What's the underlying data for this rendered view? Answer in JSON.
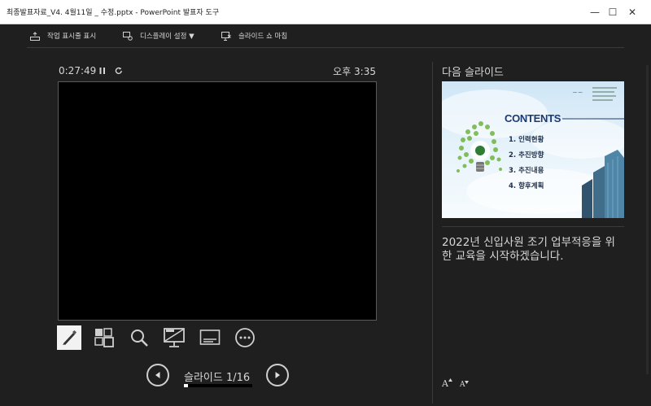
{
  "window": {
    "title": "최종발표자료_V4. 4월11일 _ 수정.pptx - PowerPoint 발표자 도구",
    "minimize": "—",
    "maximize": "☐",
    "close": "✕"
  },
  "toolbar": {
    "taskbar_label": "작업 표시줄 표시",
    "display_label": "디스플레이 설정 ▼",
    "end_label": "슬라이드 쇼 마침"
  },
  "presenter": {
    "elapsed": "0:27:49",
    "clock": "오후 3:35",
    "counter": "슬라이드 1/16",
    "progress_fraction": 0.0625
  },
  "next": {
    "label": "다음 슬라이드",
    "thumb": {
      "heading": "CONTENTS",
      "items": [
        "1. 인력현황",
        "2. 추진방향",
        "3. 추진내용",
        "4. 향후계획"
      ]
    }
  },
  "notes": {
    "text": "2022년 신입사원 조기 업부적응을 위한 교육을 시작하겠습니다."
  },
  "font_controls": {
    "increase": "A",
    "decrease": "A"
  },
  "colors": {
    "background": "#1f1f1f",
    "accent_heading": "#1b3a73"
  }
}
